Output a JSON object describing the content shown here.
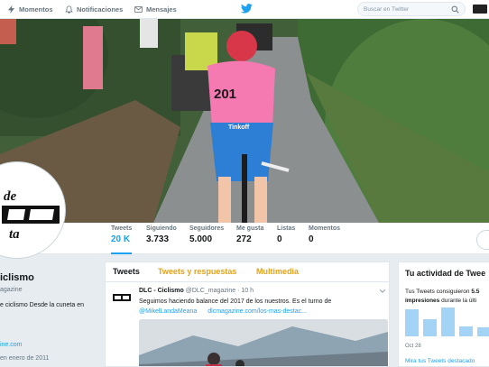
{
  "topnav": {
    "moments": "Momentos",
    "notifications": "Notificaciones",
    "messages": "Mensajes",
    "search_placeholder": "Buscar en Twitter"
  },
  "stats": [
    {
      "label": "Tweets",
      "value": "20 K"
    },
    {
      "label": "Siguiendo",
      "value": "3.733"
    },
    {
      "label": "Seguidores",
      "value": "5.000"
    },
    {
      "label": "Me gusta",
      "value": "272"
    },
    {
      "label": "Listas",
      "value": "0"
    },
    {
      "label": "Momentos",
      "value": "0"
    }
  ],
  "banner": {
    "bib_number": "201",
    "kit_text": "Tinkoff"
  },
  "profile": {
    "name": "iclismo",
    "handle": "agazine",
    "bio_line1": "e ciclismo Desde la cuneta en",
    "bio_line2": "",
    "link": "ine.com",
    "joined": "en enero de 2011",
    "logo_line1": "de",
    "logo_line2": "ta"
  },
  "tabs": {
    "tweets": "Tweets",
    "replies": "Tweets y respuestas",
    "media": "Multimedia"
  },
  "tweet": {
    "author": "DLC - Ciclismo",
    "handle": "@DLC_magazine",
    "time": "· 10 h",
    "text": "Seguimos haciendo balance del 2017 de los nuestros. Es el turno de",
    "mention": "@MikelLandaMeana",
    "link": "dlcmagazine.com/los-mas-destac..."
  },
  "activity": {
    "title": "Tu actividad de Twee",
    "line1_pre": "Tus Tweets consiguieron ",
    "line1_bold": "5.5",
    "line2_bold": "impresiones",
    "line2_post": " durante la últi",
    "date": "Oct 28",
    "more": "Mira tus Tweets destacado",
    "bars": [
      0.95,
      0.6,
      1.0,
      0.35,
      0.3
    ]
  },
  "colors": {
    "accent": "#1da1f2",
    "orange_tab": "#e8a21a",
    "jersey_pink": "#f57ab2",
    "shorts_blue": "#2d7fd6"
  }
}
